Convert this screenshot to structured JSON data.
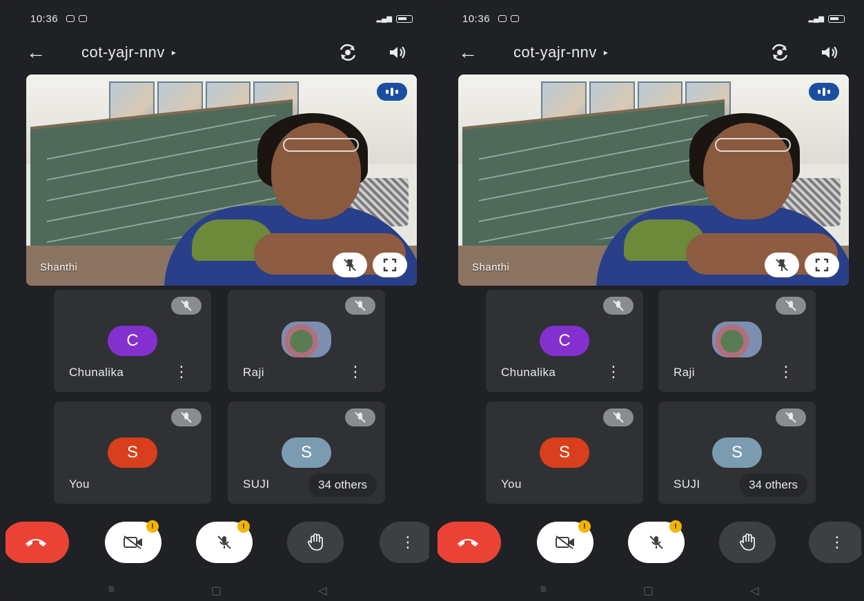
{
  "status_bar": {
    "time": "10:36"
  },
  "top_bar": {
    "meeting_code": "cot-yajr-nnv",
    "caret": "▸",
    "back_icon": "arrow-left-icon",
    "camera_switch_icon": "switch-camera-icon",
    "speaker_icon": "speaker-icon"
  },
  "main_video": {
    "participant_name": "Shanthi"
  },
  "tiles": [
    {
      "name": "Chunalika",
      "initial": "C",
      "color": "#8430ce",
      "has_menu": true
    },
    {
      "name": "Raji",
      "initial": "",
      "color": "",
      "has_menu": true,
      "photo": true
    },
    {
      "name": "You",
      "initial": "S",
      "color": "#d93f1c",
      "has_menu": false
    },
    {
      "name": "SUJI",
      "initial": "S",
      "color": "#7b9cb0",
      "has_menu": false
    }
  ],
  "others_pill": "34 others",
  "controls": {
    "end_call_icon": "end-call-icon",
    "camera_icon": "camera-off-icon",
    "mic_icon": "mic-off-icon",
    "raise_hand_icon": "raise-hand-icon",
    "more_icon": "more-vert-icon",
    "notif_badge": "!"
  },
  "colors": {
    "end_call": "#ea4335",
    "notif": "#f4b400",
    "accent_badge": "#1a4fa0"
  }
}
